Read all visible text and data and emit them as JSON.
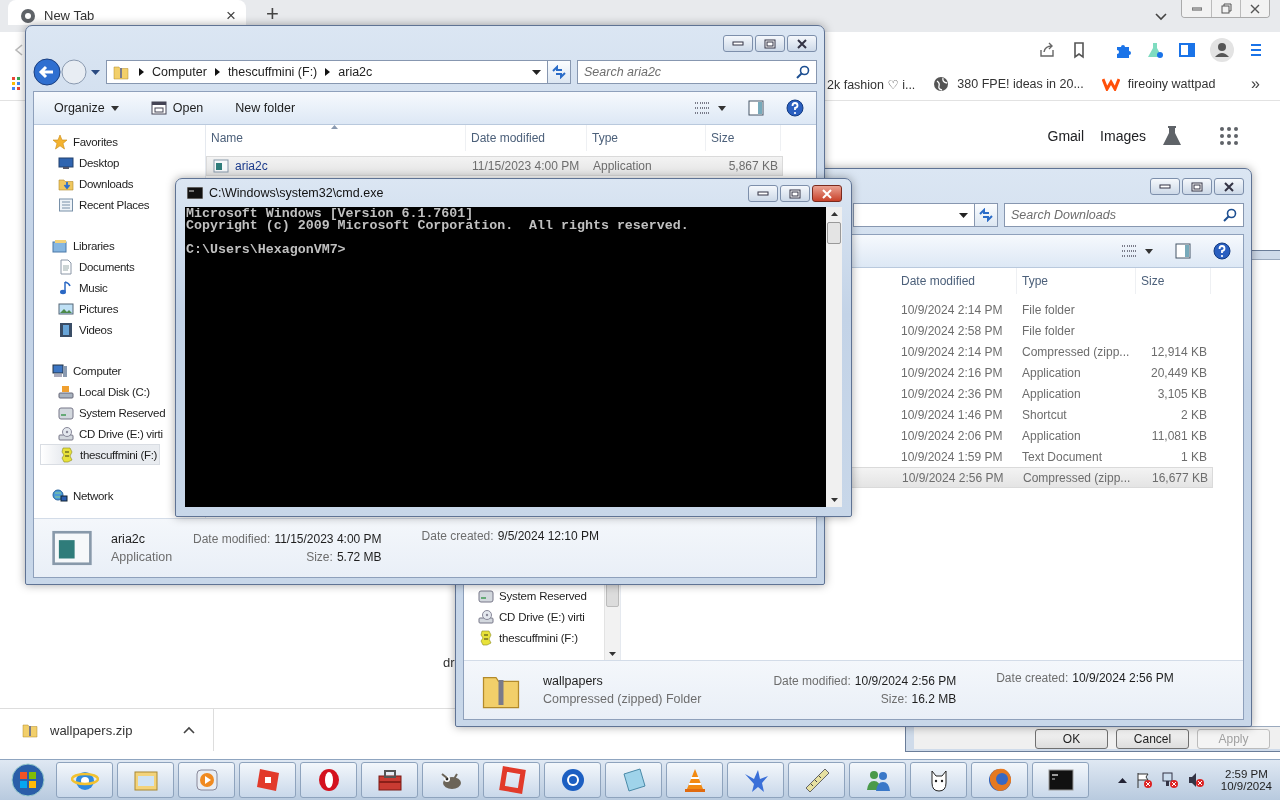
{
  "browser": {
    "tab": {
      "title": "New Tab",
      "close": "×"
    },
    "new_tab": "+",
    "bookmarks": [
      {
        "label": "2k fashion ♡ i...",
        "kind": "plain"
      },
      {
        "label": "380 FPE! ideas in 20...",
        "kind": "globe"
      },
      {
        "label": "fireoiny wattpad",
        "kind": "wattpad"
      }
    ],
    "bookmarks_more": "»",
    "header_links": [
      "Gmail",
      "Images"
    ],
    "page_fragment": "dr",
    "download": {
      "file": "wallpapers.zip"
    }
  },
  "properties_dialog": {
    "buttons": [
      {
        "label": "OK",
        "disabled": false
      },
      {
        "label": "Cancel",
        "disabled": false
      },
      {
        "label": "Apply",
        "disabled": true
      }
    ]
  },
  "downloads_window": {
    "search": {
      "placeholder": "Search Downloads"
    },
    "columns": [
      "Date modified",
      "Type",
      "Size"
    ],
    "rows": [
      {
        "date": "10/9/2024 2:14 PM",
        "type": "File folder",
        "selected": false
      },
      {
        "date": "10/9/2024 2:58 PM",
        "type": "File folder",
        "selected": false
      },
      {
        "date": "10/9/2024 2:14 PM",
        "type": "Compressed (zipp...",
        "size": "12,914 KB",
        "selected": false
      },
      {
        "date": "10/9/2024 2:16 PM",
        "type": "Application",
        "size": "20,449 KB",
        "selected": false
      },
      {
        "date": "10/9/2024 2:36 PM",
        "type": "Application",
        "size": "3,105 KB",
        "selected": false
      },
      {
        "date": "10/9/2024 1:46 PM",
        "type": "Shortcut",
        "size": "2 KB",
        "selected": false
      },
      {
        "date": "10/9/2024 2:06 PM",
        "type": "Application",
        "size": "11,081 KB",
        "selected": false
      },
      {
        "date": "10/9/2024 1:59 PM",
        "type": "Text Document",
        "size": "1 KB",
        "selected": false
      },
      {
        "date": "10/9/2024 2:56 PM",
        "type": "Compressed (zipp...",
        "size": "16,677 KB",
        "selected": true
      }
    ],
    "nav_items": [
      {
        "label": "System Reserved",
        "selected": false
      },
      {
        "label": "CD Drive (E:) virti",
        "selected": false
      },
      {
        "label": "thescuffmini (F:)",
        "selected": false
      }
    ],
    "details": {
      "name": "wallpapers",
      "type": "Compressed (zipped) Folder",
      "columns": [
        [
          {
            "label": "Date modified:",
            "value": "10/9/2024 2:56 PM"
          },
          {
            "label": "Size:",
            "value": "16.2 MB"
          }
        ],
        [
          {
            "label": "Date created:",
            "value": "10/9/2024 2:56 PM"
          }
        ]
      ]
    }
  },
  "explorer_window": {
    "address": [
      "Computer",
      "thescuffmini (F:)",
      "aria2c"
    ],
    "search": {
      "placeholder": "Search aria2c"
    },
    "commands": [
      "Organize",
      "Open",
      "New folder"
    ],
    "nav_groups": [
      {
        "label": "Favorites",
        "selected": false,
        "children": [
          {
            "label": "Desktop",
            "selected": false
          },
          {
            "label": "Downloads",
            "selected": false
          },
          {
            "label": "Recent Places",
            "selected": false
          }
        ]
      },
      {
        "label": "Libraries",
        "selected": false,
        "children": [
          {
            "label": "Documents",
            "selected": false
          },
          {
            "label": "Music",
            "selected": false
          },
          {
            "label": "Pictures",
            "selected": false
          },
          {
            "label": "Videos",
            "selected": false
          }
        ]
      },
      {
        "label": "Computer",
        "selected": false,
        "children": [
          {
            "label": "Local Disk (C:)",
            "selected": false
          },
          {
            "label": "System Reserved",
            "selected": false
          },
          {
            "label": "CD Drive (E:) virti",
            "selected": false
          },
          {
            "label": "thescuffmini (F:)",
            "selected": true
          }
        ]
      },
      {
        "label": "Network",
        "selected": false
      }
    ],
    "columns": [
      "Name",
      "Date modified",
      "Type",
      "Size"
    ],
    "rows": [
      {
        "name": "aria2c",
        "date": "11/15/2023 4:00 PM",
        "type": "Application",
        "size": "5,867 KB",
        "selected": true
      }
    ],
    "details": {
      "name": "aria2c",
      "type": "Application",
      "columns": [
        [
          {
            "label": "Date modified:",
            "value": "11/15/2023 4:00 PM"
          },
          {
            "label": "Size:",
            "value": "5.72 MB"
          }
        ],
        [
          {
            "label": "Date created:",
            "value": "9/5/2024 12:10 PM"
          }
        ]
      ]
    }
  },
  "console": {
    "title": "C:\\Windows\\system32\\cmd.exe",
    "lines": [
      "Microsoft Windows [Version 6.1.7601]",
      "Copyright (c) 2009 Microsoft Corporation.  All rights reserved."
    ],
    "prompt": "C:\\Users\\HexagonVM7>"
  },
  "taskbar": {
    "time": "2:59 PM",
    "date": "10/9/2024"
  }
}
